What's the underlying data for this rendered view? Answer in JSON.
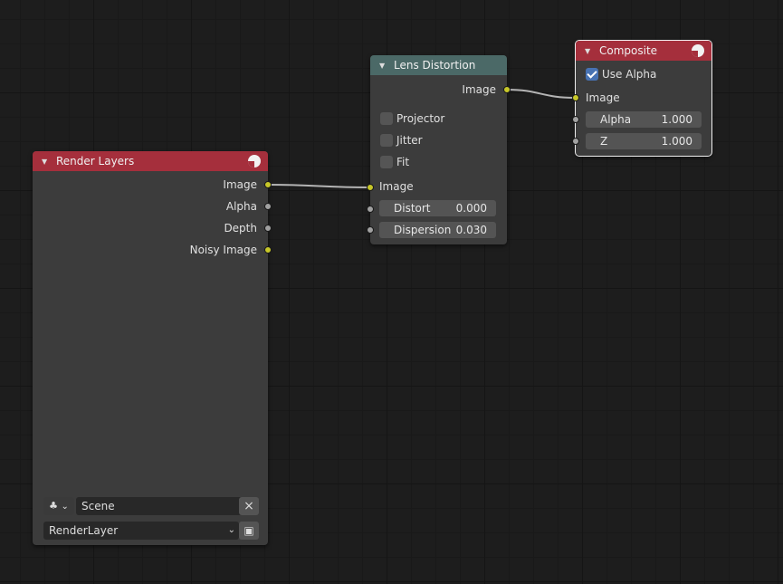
{
  "nodes": {
    "render_layers": {
      "title": "Render Layers",
      "outputs": [
        "Image",
        "Alpha",
        "Depth",
        "Noisy Image"
      ],
      "scene_value": "Scene",
      "layer_value": "RenderLayer",
      "clear_glyph": "×",
      "chevron_glyph": "⌄"
    },
    "lens_distortion": {
      "title": "Lens Distortion",
      "output": "Image",
      "checkboxes": [
        {
          "label": "Projector",
          "checked": false
        },
        {
          "label": "Jitter",
          "checked": false
        },
        {
          "label": "Fit",
          "checked": false
        }
      ],
      "input_image": "Image",
      "distort": {
        "label": "Distort",
        "value": "0.000"
      },
      "dispersion": {
        "label": "Dispersion",
        "value": "0.030"
      }
    },
    "composite": {
      "title": "Composite",
      "use_alpha": {
        "label": "Use Alpha",
        "checked": true
      },
      "input_image": "Image",
      "alpha": {
        "label": "Alpha",
        "value": "1.000"
      },
      "z": {
        "label": "Z",
        "value": "1.000"
      }
    }
  },
  "colors": {
    "render_header": "#a52f3c",
    "converter_header": "#4b6967",
    "image_socket": "#c7c729",
    "value_socket": "#a1a1a1",
    "checkbox_checked": "#4772b3",
    "link": "#b4b4b4"
  },
  "icons": {
    "collapse": "triangle-down-icon",
    "render": "render-result-icon",
    "scene_browse": "scene-data-icon",
    "layer_browse": "render-layer-browse-icon"
  }
}
